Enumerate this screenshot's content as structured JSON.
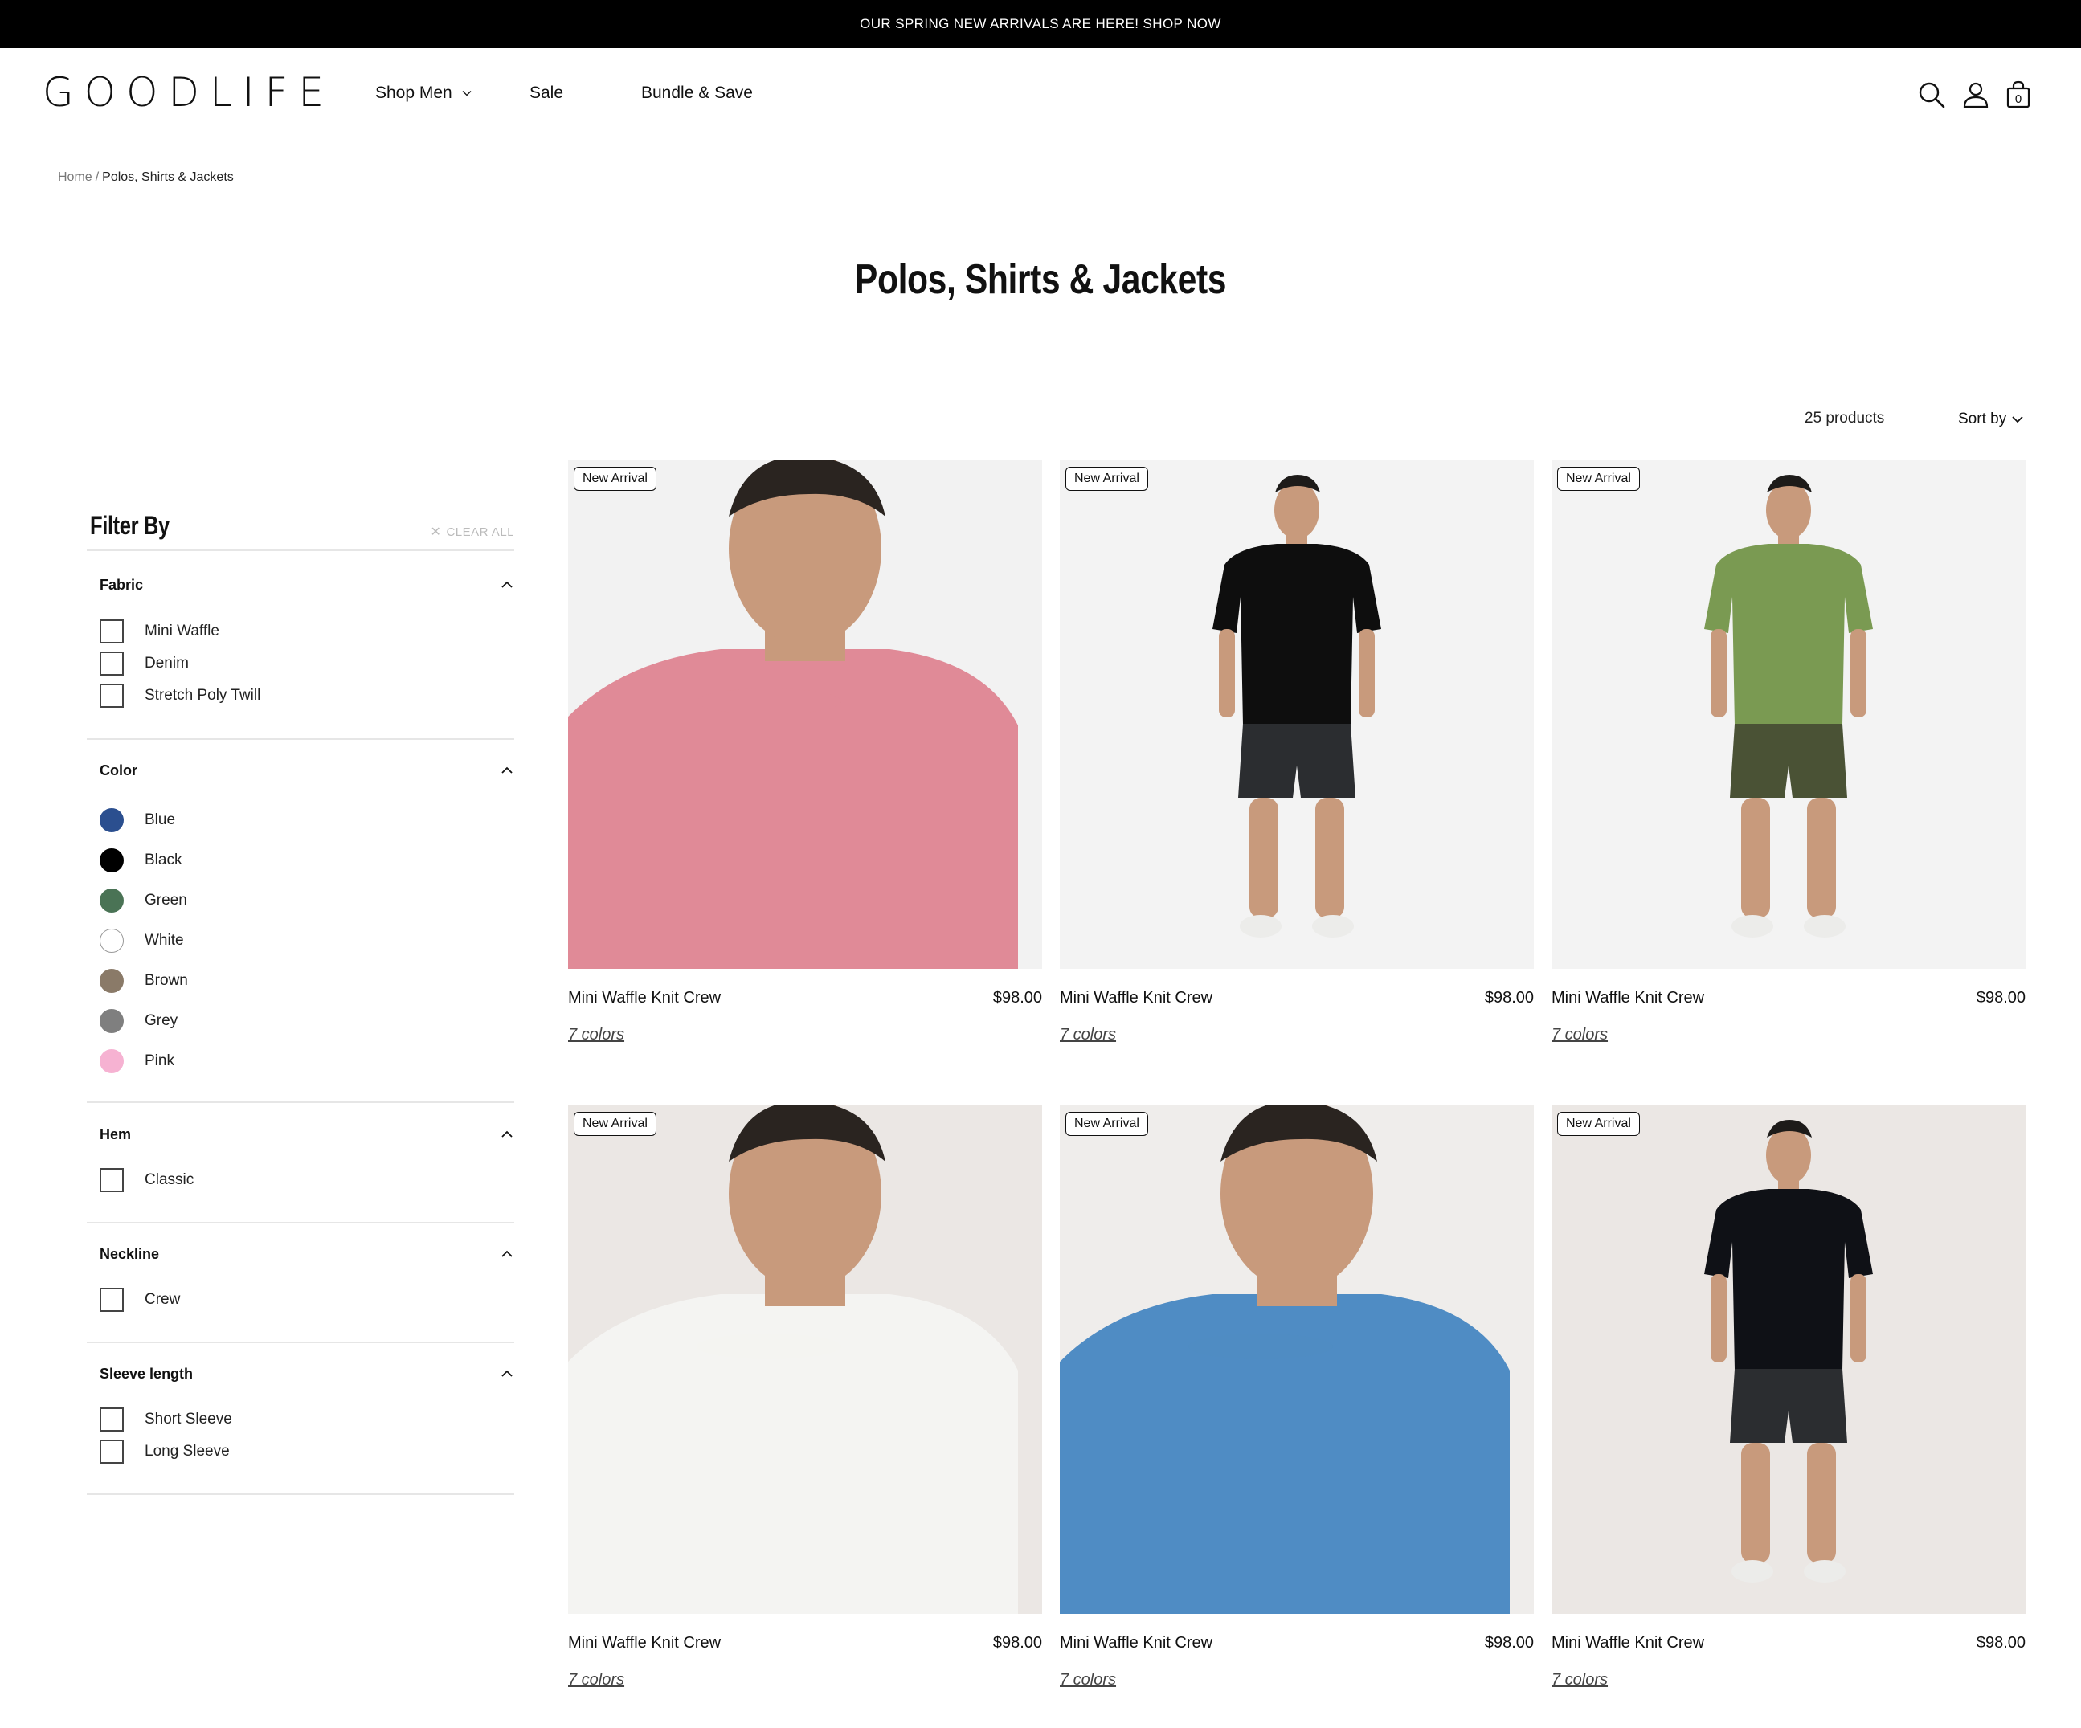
{
  "announcement": "OUR SPRING NEW ARRIVALS ARE HERE! SHOP NOW",
  "header": {
    "logo": "GOODLIFE",
    "nav": [
      "Shop Men",
      "Sale",
      "Bundle & Save"
    ],
    "cart_count": "0",
    "icons": [
      "search-icon",
      "account-icon",
      "cart-icon"
    ]
  },
  "breadcrumb": {
    "home": "Home",
    "separator": "/",
    "current": "Polos, Shirts & Jackets"
  },
  "page_title": "Polos, Shirts & Jackets",
  "toolbar": {
    "count": "25 products",
    "sort_label": "Sort by"
  },
  "filters": {
    "title": "Filter By",
    "clear_all": "CLEAR ALL",
    "groups": [
      {
        "name": "Fabric",
        "options": [
          "Mini Waffle",
          "Denim",
          "Stretch Poly Twill"
        ]
      },
      {
        "name": "Color",
        "options": [
          {
            "label": "Blue",
            "color": "#2b4f8f"
          },
          {
            "label": "Black",
            "color": "#000000"
          },
          {
            "label": "Green",
            "color": "#4a7355"
          },
          {
            "label": "White",
            "color": "#ffffff"
          },
          {
            "label": "Brown",
            "color": "#8a7a68"
          },
          {
            "label": "Grey",
            "color": "#7f7f7f"
          },
          {
            "label": "Pink",
            "color": "#f6b2d2"
          }
        ]
      },
      {
        "name": "Hem",
        "options": [
          "Classic"
        ]
      },
      {
        "name": "Neckline",
        "options": [
          "Crew"
        ]
      },
      {
        "name": "Sleeve length",
        "options": [
          "Short Sleeve",
          "Long Sleeve"
        ]
      }
    ]
  },
  "products": [
    {
      "badge": "New Arrival",
      "name": "Mini Waffle Knit Crew",
      "price": "$98.00",
      "colors": "7 colors",
      "shirt_color": "#e08a97"
    },
    {
      "badge": "New Arrival",
      "name": "Mini Waffle Knit Crew",
      "price": "$98.00",
      "colors": "7 colors",
      "shirt_color": "#0e0e0e"
    },
    {
      "badge": "New Arrival",
      "name": "Mini Waffle Knit Crew",
      "price": "$98.00",
      "colors": "7 colors",
      "shirt_color": "#7a9a52"
    },
    {
      "badge": "New Arrival",
      "name": "Mini Waffle Knit Crew",
      "price": "$98.00",
      "colors": "7 colors",
      "shirt_color": "#f4f4f2"
    },
    {
      "badge": "New Arrival",
      "name": "Mini Waffle Knit Crew",
      "price": "$98.00",
      "colors": "7 colors",
      "shirt_color": "#4f8cc4"
    },
    {
      "badge": "New Arrival",
      "name": "Mini Waffle Knit Crew",
      "price": "$98.00",
      "colors": "7 colors",
      "shirt_color": "#0f1116"
    }
  ]
}
